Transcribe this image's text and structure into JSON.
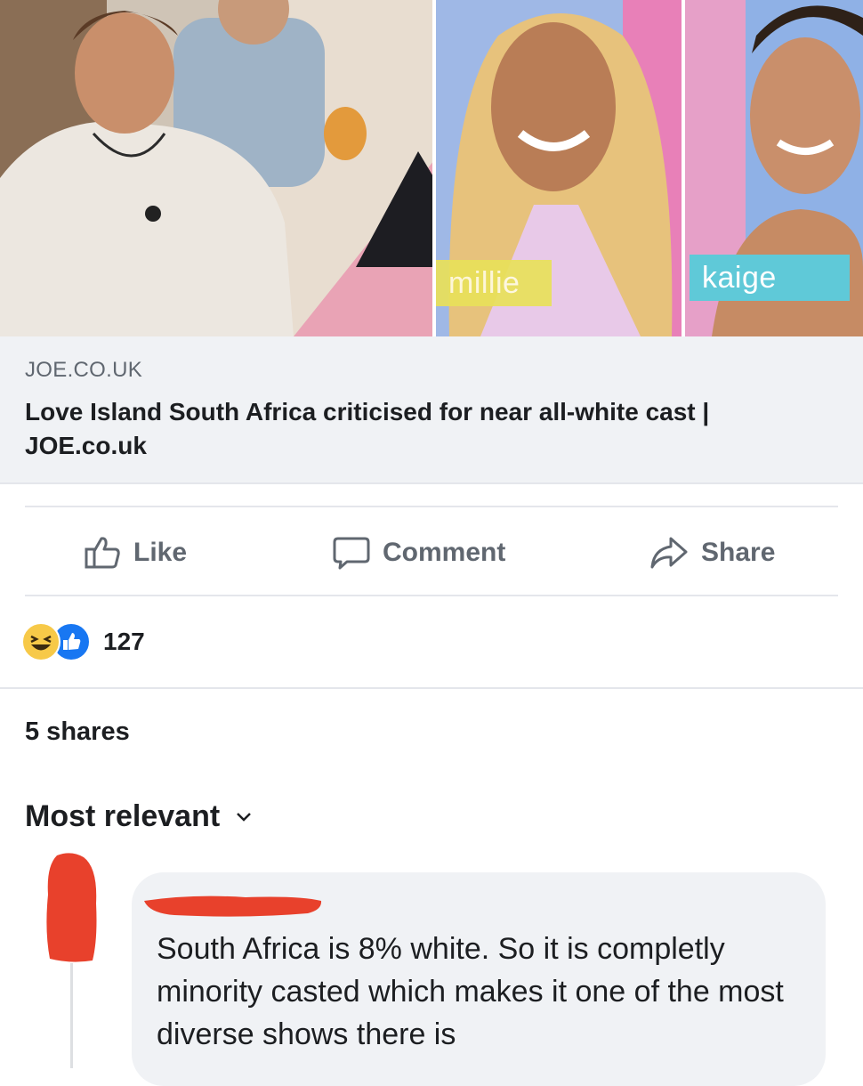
{
  "hero": {
    "name_tags": [
      "millie",
      "kaige"
    ]
  },
  "link_card": {
    "domain": "JOE.CO.UK",
    "headline": "Love Island South Africa criticised for near all-white cast | JOE.co.uk"
  },
  "actions": {
    "like_label": "Like",
    "comment_label": "Comment",
    "share_label": "Share"
  },
  "reactions": {
    "count": "127",
    "icons": [
      "haha-icon",
      "like-icon"
    ]
  },
  "shares_text": "5 shares",
  "sort": {
    "label": "Most relevant",
    "icon": "chevron-down-icon"
  },
  "comment": {
    "text": "South Africa is 8% white. So it is completly minority casted which makes it one of the most diverse shows there is"
  },
  "colors": {
    "accent": "#1877f2",
    "muted_text": "#606770",
    "card_bg": "#f0f2f5",
    "redaction": "#e8412c",
    "haha": "#f7c948"
  }
}
